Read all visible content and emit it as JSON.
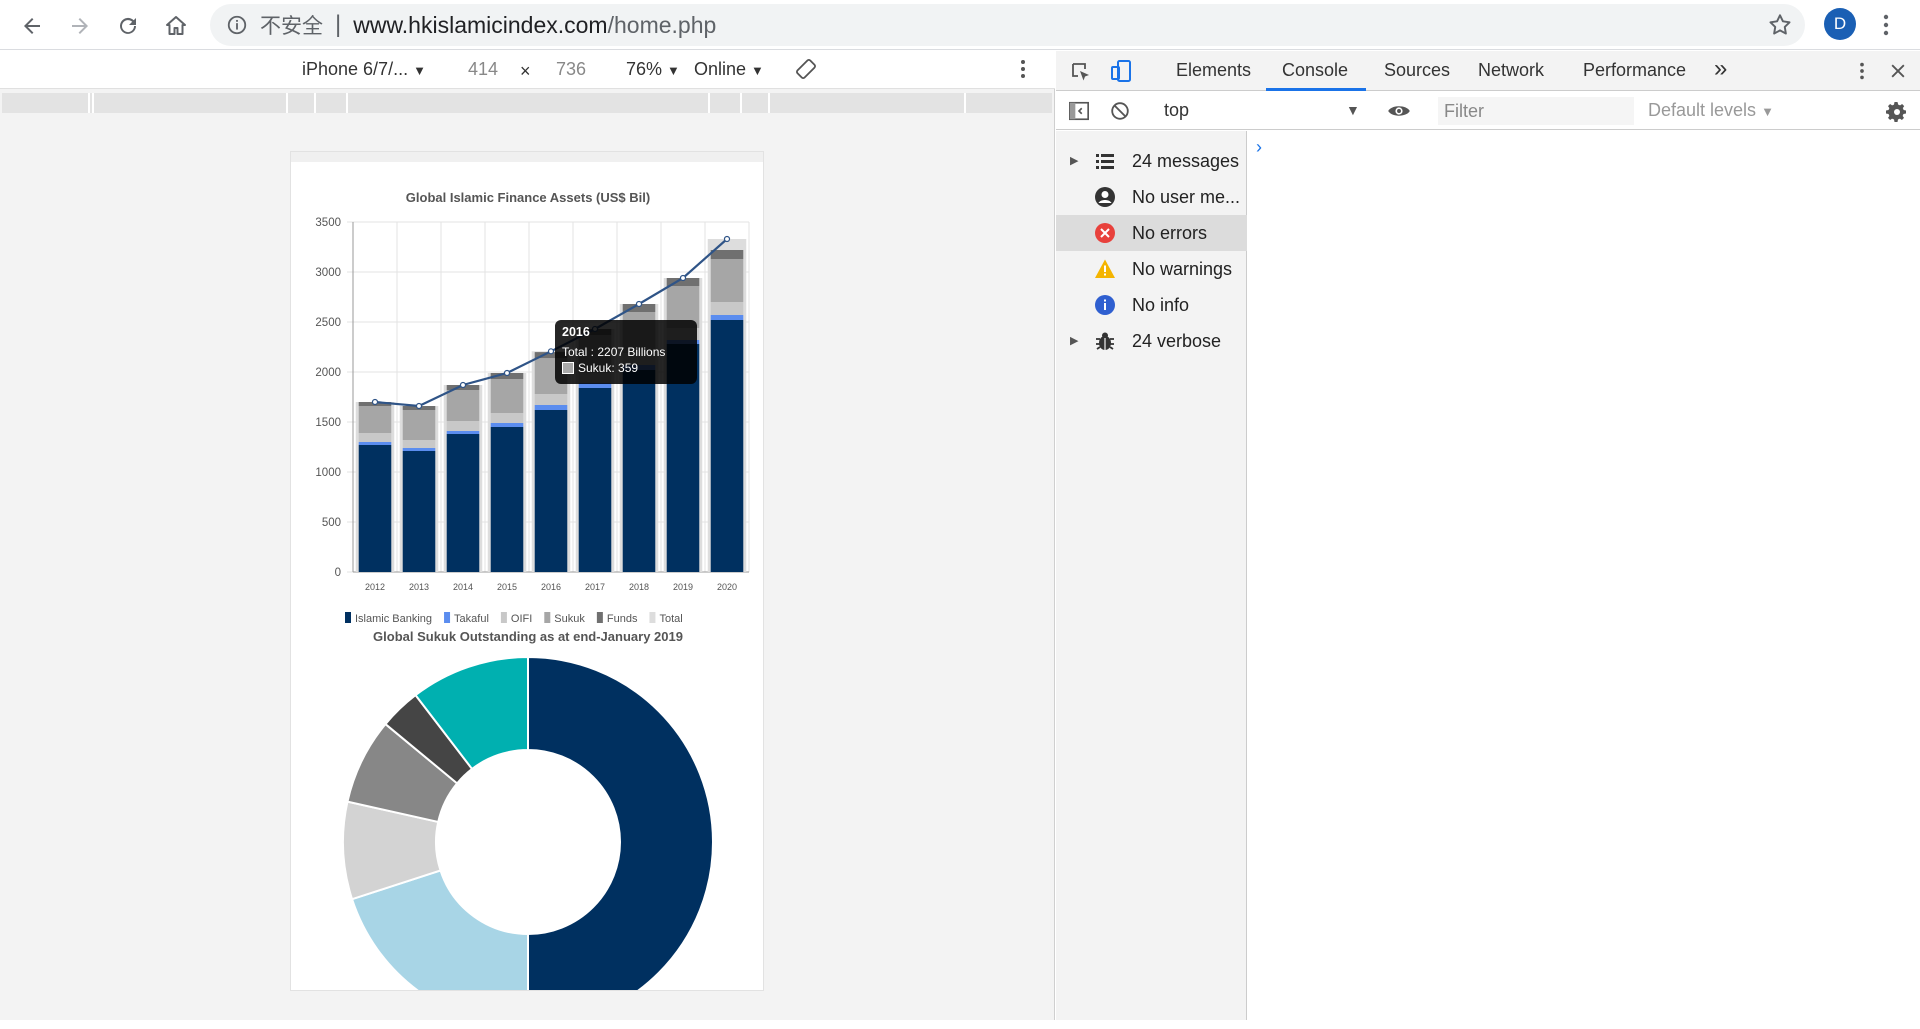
{
  "browser": {
    "security_label": "不安全",
    "separator": "|",
    "url_host": "www.hkislamicindex.com",
    "url_path": "/home.php",
    "profile_initial": "D"
  },
  "device_toolbar": {
    "device": "iPhone 6/7/...",
    "width": "414",
    "times": "×",
    "height": "736",
    "zoom": "76%",
    "network": "Online"
  },
  "devtools": {
    "tabs": [
      "Elements",
      "Console",
      "Sources",
      "Network",
      "Performance"
    ],
    "active_tab": "Console",
    "more_tabs": "»",
    "context": "top",
    "filter_placeholder": "Filter",
    "levels": "Default levels",
    "sidebar": [
      {
        "label": "24 messages",
        "icon": "list-icon",
        "expandable": true
      },
      {
        "label": "No user me...",
        "icon": "user-icon",
        "expandable": false
      },
      {
        "label": "No errors",
        "icon": "error-icon",
        "expandable": false,
        "selected": true
      },
      {
        "label": "No warnings",
        "icon": "warning-icon",
        "expandable": false
      },
      {
        "label": "No info",
        "icon": "info-icon",
        "expandable": false
      },
      {
        "label": "24 verbose",
        "icon": "bug-icon",
        "expandable": true
      }
    ],
    "prompt": "›"
  },
  "colors": {
    "islamic_banking": "#003060",
    "takaful": "#5b8def",
    "oifi": "#c8c8c8",
    "sukuk": "#a6a6a6",
    "funds": "#707070",
    "total": "#dddddd",
    "total_line": "#2f5487",
    "accent": "#1a73e8"
  },
  "chart_data": [
    {
      "type": "bar",
      "stacked": true,
      "title": "Global Islamic Finance Assets (US$ Bil)",
      "categories": [
        "2012",
        "2013",
        "2014",
        "2015",
        "2016",
        "2017",
        "2018",
        "2019",
        "2020"
      ],
      "ylim": [
        0,
        3500
      ],
      "yticks": [
        0,
        500,
        1000,
        1500,
        2000,
        2500,
        3000,
        3500
      ],
      "grid": true,
      "legend": "bottom",
      "series": [
        {
          "name": "Islamic Banking",
          "values": [
            1270,
            1210,
            1380,
            1450,
            1620,
            1840,
            2020,
            2280,
            2520
          ]
        },
        {
          "name": "Takaful",
          "values": [
            30,
            30,
            30,
            40,
            50,
            50,
            50,
            40,
            50
          ]
        },
        {
          "name": "OIFI",
          "values": [
            90,
            80,
            100,
            100,
            110,
            100,
            120,
            120,
            130
          ]
        },
        {
          "name": "Sukuk",
          "values": [
            270,
            300,
            310,
            340,
            359,
            380,
            410,
            420,
            430
          ]
        },
        {
          "name": "Funds",
          "values": [
            40,
            40,
            50,
            60,
            60,
            60,
            80,
            80,
            90
          ]
        },
        {
          "name": "Total",
          "type": "line",
          "values": [
            1700,
            1660,
            1870,
            1990,
            2207,
            2430,
            2680,
            2940,
            3330
          ]
        }
      ],
      "tooltip": {
        "year": "2016",
        "total_line": "Total  :  2207  Billions",
        "sukuk_line": "Sukuk: 359"
      }
    },
    {
      "type": "pie",
      "donut": true,
      "title": "Global Sukuk Outstanding as at end-January 2019",
      "slices": [
        {
          "value": 50.0,
          "color": "#003060"
        },
        {
          "value": 20.0,
          "color": "#a8d5e6"
        },
        {
          "value": 8.5,
          "color": "#d3d3d3"
        },
        {
          "value": 7.5,
          "color": "#878787"
        },
        {
          "value": 3.6,
          "color": "#454545"
        },
        {
          "value": 10.4,
          "color": "#00b0b0"
        }
      ]
    }
  ]
}
